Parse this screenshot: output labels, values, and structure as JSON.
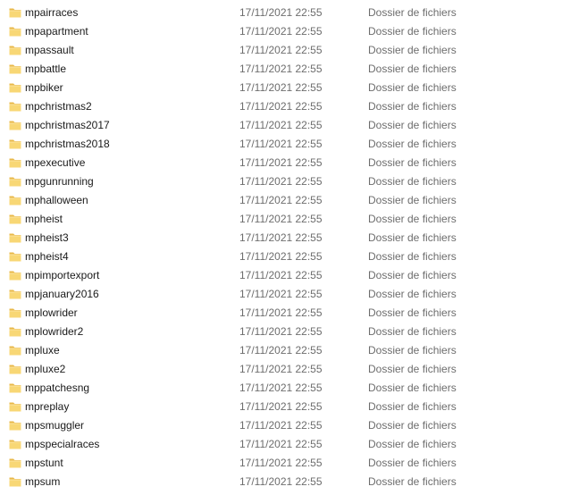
{
  "rows": [
    {
      "name": "mpairraces",
      "date": "17/11/2021 22:55",
      "type": "Dossier de fichiers"
    },
    {
      "name": "mpapartment",
      "date": "17/11/2021 22:55",
      "type": "Dossier de fichiers"
    },
    {
      "name": "mpassault",
      "date": "17/11/2021 22:55",
      "type": "Dossier de fichiers"
    },
    {
      "name": "mpbattle",
      "date": "17/11/2021 22:55",
      "type": "Dossier de fichiers"
    },
    {
      "name": "mpbiker",
      "date": "17/11/2021 22:55",
      "type": "Dossier de fichiers"
    },
    {
      "name": "mpchristmas2",
      "date": "17/11/2021 22:55",
      "type": "Dossier de fichiers"
    },
    {
      "name": "mpchristmas2017",
      "date": "17/11/2021 22:55",
      "type": "Dossier de fichiers"
    },
    {
      "name": "mpchristmas2018",
      "date": "17/11/2021 22:55",
      "type": "Dossier de fichiers"
    },
    {
      "name": "mpexecutive",
      "date": "17/11/2021 22:55",
      "type": "Dossier de fichiers"
    },
    {
      "name": "mpgunrunning",
      "date": "17/11/2021 22:55",
      "type": "Dossier de fichiers"
    },
    {
      "name": "mphalloween",
      "date": "17/11/2021 22:55",
      "type": "Dossier de fichiers"
    },
    {
      "name": "mpheist",
      "date": "17/11/2021 22:55",
      "type": "Dossier de fichiers"
    },
    {
      "name": "mpheist3",
      "date": "17/11/2021 22:55",
      "type": "Dossier de fichiers"
    },
    {
      "name": "mpheist4",
      "date": "17/11/2021 22:55",
      "type": "Dossier de fichiers"
    },
    {
      "name": "mpimportexport",
      "date": "17/11/2021 22:55",
      "type": "Dossier de fichiers"
    },
    {
      "name": "mpjanuary2016",
      "date": "17/11/2021 22:55",
      "type": "Dossier de fichiers"
    },
    {
      "name": "mplowrider",
      "date": "17/11/2021 22:55",
      "type": "Dossier de fichiers"
    },
    {
      "name": "mplowrider2",
      "date": "17/11/2021 22:55",
      "type": "Dossier de fichiers"
    },
    {
      "name": "mpluxe",
      "date": "17/11/2021 22:55",
      "type": "Dossier de fichiers"
    },
    {
      "name": "mpluxe2",
      "date": "17/11/2021 22:55",
      "type": "Dossier de fichiers"
    },
    {
      "name": "mppatchesng",
      "date": "17/11/2021 22:55",
      "type": "Dossier de fichiers"
    },
    {
      "name": "mpreplay",
      "date": "17/11/2021 22:55",
      "type": "Dossier de fichiers"
    },
    {
      "name": "mpsmuggler",
      "date": "17/11/2021 22:55",
      "type": "Dossier de fichiers"
    },
    {
      "name": "mpspecialraces",
      "date": "17/11/2021 22:55",
      "type": "Dossier de fichiers"
    },
    {
      "name": "mpstunt",
      "date": "17/11/2021 22:55",
      "type": "Dossier de fichiers"
    },
    {
      "name": "mpsum",
      "date": "17/11/2021 22:55",
      "type": "Dossier de fichiers"
    }
  ],
  "icons": {
    "folder": "folder-icon"
  },
  "colors": {
    "folder_body": "#f8d775",
    "folder_tab": "#e8b84a",
    "secondary_text": "#6d6d6d"
  }
}
